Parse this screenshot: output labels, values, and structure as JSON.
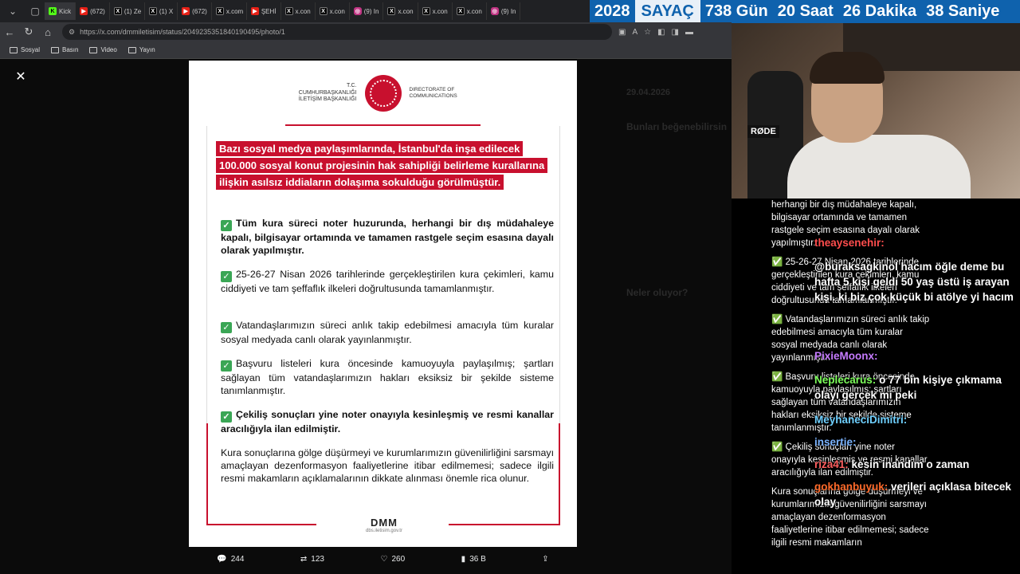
{
  "browser": {
    "tabs": [
      {
        "label": "Kick",
        "icon": "kick"
      },
      {
        "label": "(672)",
        "icon": "youtube"
      },
      {
        "label": "(1) Ze",
        "icon": "x"
      },
      {
        "label": "(1) X",
        "icon": "x"
      },
      {
        "label": "(672)",
        "icon": "youtube"
      },
      {
        "label": "x.com",
        "icon": "x"
      },
      {
        "label": "ŞEHİ",
        "icon": "youtube"
      },
      {
        "label": "x.con",
        "icon": "x"
      },
      {
        "label": "x.con",
        "icon": "x"
      },
      {
        "label": "(9) In",
        "icon": "instagram"
      },
      {
        "label": "x.con",
        "icon": "x"
      },
      {
        "label": "x.con",
        "icon": "x"
      },
      {
        "label": "x.con",
        "icon": "x"
      },
      {
        "label": "(9) In",
        "icon": "instagram"
      }
    ],
    "url": "https://x.com/dmmiletisim/status/2049235351840190495/photo/1",
    "bookmarks": [
      "Sosyal",
      "Basın",
      "Video",
      "Yayın"
    ]
  },
  "counter": {
    "year": "2028",
    "label": "SAYAÇ",
    "days": "738 Gün",
    "hours": "20 Saat",
    "minutes": "26 Dakika",
    "seconds": "38 Saniye"
  },
  "post": {
    "logo_left": "T.C. CUMHURBAŞKANLIĞI İLETİŞİM BAŞKANLIĞI",
    "logo_right": "DIRECTORATE OF COMMUNICATIONS",
    "headline": "Bazı sosyal medya paylaşımlarında, İstanbul'da inşa edilecek 100.000 sosyal konut projesinin hak sahipliği belirleme kurallarına ilişkin asılsız iddiaların dolaşıma sokulduğu görülmüştür.",
    "items": [
      "Tüm kura süreci noter huzurunda, herhangi bir dış müdahaleye kapalı, bilgisayar ortamında ve tamamen rastgele seçim esasına dayalı olarak yapılmıştır.",
      "25-26-27 Nisan 2026 tarihlerinde gerçekleştirilen kura çekimleri, kamu ciddiyeti ve tam şeffaflık ilkeleri doğrultusunda tamamlanmıştır.",
      "Vatandaşlarımızın süreci anlık takip edebilmesi amacıyla tüm kuralar sosyal medyada canlı olarak yayınlanmıştır.",
      "Başvuru listeleri kura öncesinde kamuoyuyla paylaşılmış; şartları sağlayan tüm vatandaşlarımızın hakları eksiksiz bir şekilde sisteme tanımlanmıştır.",
      "Çekiliş sonuçları yine noter onayıyla kesinleşmiş ve resmi kanallar aracılığıyla ilan edilmiştir."
    ],
    "closing": "Kura sonuçlarına gölge düşürmeyi ve kurumlarımızın güvenilirliğini sarsmayı amaçlayan dezenformasyon faaliyetlerine itibar edilmemesi; sadece ilgili resmi makamların açıklamalarının dikkate alınması önemle rica olunur.",
    "footer_brand": "DMM",
    "footer_url": "dbs.iletisim.gov.tr"
  },
  "post_actions": {
    "replies": "244",
    "reposts": "123",
    "likes": "260",
    "views": "36 B"
  },
  "ghost_ui": {
    "date": "29.04.2026",
    "suggest": "Bunları beğenebilirsin",
    "trends": "Neler oluyor?"
  },
  "webcam": {
    "mic_brand": "RØDE"
  },
  "chat": {
    "doc_text": [
      "herhangi bir dış müdahaleye kapalı, bilgisayar ortamında ve tamamen rastgele seçim esasına dayalı olarak yapılmıştır.",
      "✅ 25-26-27 Nisan 2026 tarihlerinde gerçekleştirilen kura çekimleri, kamu ciddiyeti ve tam şeffaflık ilkeleri doğrultusunda tamamlanmıştır.",
      "✅ Vatandaşlarımızın süreci anlık takip edebilmesi amacıyla tüm kuralar sosyal medyada canlı olarak yayınlanmıştır.",
      "✅ Başvuru listeleri kura öncesinde kamuoyuyla paylaşılmış; şartları sağlayan tüm vatandaşlarımızın hakları eksiksiz bir şekilde sisteme tanımlanmıştır.",
      "✅ Çekiliş sonuçları yine noter onayıyla kesinleşmiş ve resmi kanallar aracılığıyla ilan edilmiştir.",
      "Kura sonuçlarına gölge düşürmeyi ve kurumlarımızın güvenilirliğini sarsmayı amaçlayan dezenformasyon faaliyetlerine itibar edilmemesi; sadece ilgili resmi makamların"
    ],
    "messages": [
      {
        "user": "theaysenehir:",
        "text": "",
        "color": "#ff4d4d"
      },
      {
        "user": "",
        "text": "@buraksagkinol hacım öğle deme bu hafta 5 kişi geldi 50 yaş üstü iş arayan kişi. ki biz çok küçük bi atölye yi hacım",
        "color": "#ff4d4d"
      },
      {
        "user": "PixieMoonx:",
        "text": "",
        "color": "#c67bff"
      },
      {
        "user": "Neplecarus:",
        "text": "o 77 bin kişiye çıkmama olayı gerçek mi peki",
        "color": "#7cff5a"
      },
      {
        "user": "MeyhaneciDimitri:",
        "text": "",
        "color": "#6fd0ff"
      },
      {
        "user": "insertie:",
        "text": "",
        "color": "#7ab3ff"
      },
      {
        "user": "riza41:",
        "text": "kesin inandım o zaman",
        "color": "#ff5f5f"
      },
      {
        "user": "gokhanbuyuk:",
        "text": "verileri açıklasa bitecek olay",
        "color": "#ff6a2a"
      }
    ]
  }
}
